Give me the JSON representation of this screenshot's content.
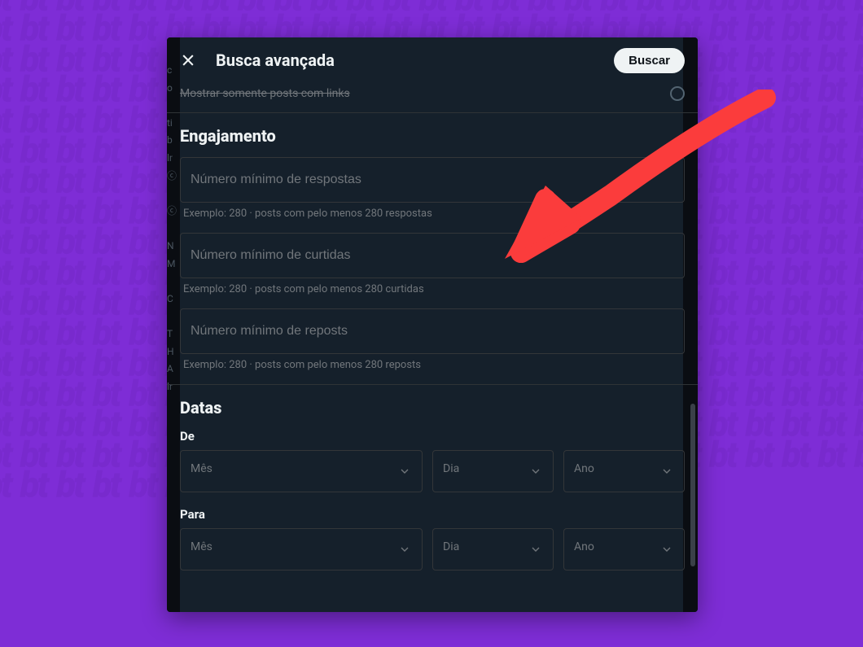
{
  "modal": {
    "title": "Busca avançada",
    "search_button": "Buscar",
    "truncated_option": "Mostrar somente posts com links"
  },
  "engagement": {
    "title": "Engajamento",
    "fields": {
      "min_replies": {
        "placeholder": "Número mínimo de respostas",
        "hint": "Exemplo: 280 · posts com pelo menos 280 respostas"
      },
      "min_likes": {
        "placeholder": "Número mínimo de curtidas",
        "hint": "Exemplo: 280 · posts com pelo menos 280 curtidas"
      },
      "min_reposts": {
        "placeholder": "Número mínimo de reposts",
        "hint": "Exemplo: 280 · posts com pelo menos 280 reposts"
      }
    }
  },
  "dates": {
    "title": "Datas",
    "from_label": "De",
    "to_label": "Para",
    "month_placeholder": "Mês",
    "day_placeholder": "Dia",
    "year_placeholder": "Ano"
  },
  "colors": {
    "page_bg": "#7e2dd6",
    "modal_bg": "#15202b",
    "text_primary": "#eff3f4",
    "text_secondary": "#71767b",
    "border": "#333639",
    "button_bg": "#eff3f4",
    "button_text": "#0f1419",
    "annotation": "#fb3c3c"
  }
}
